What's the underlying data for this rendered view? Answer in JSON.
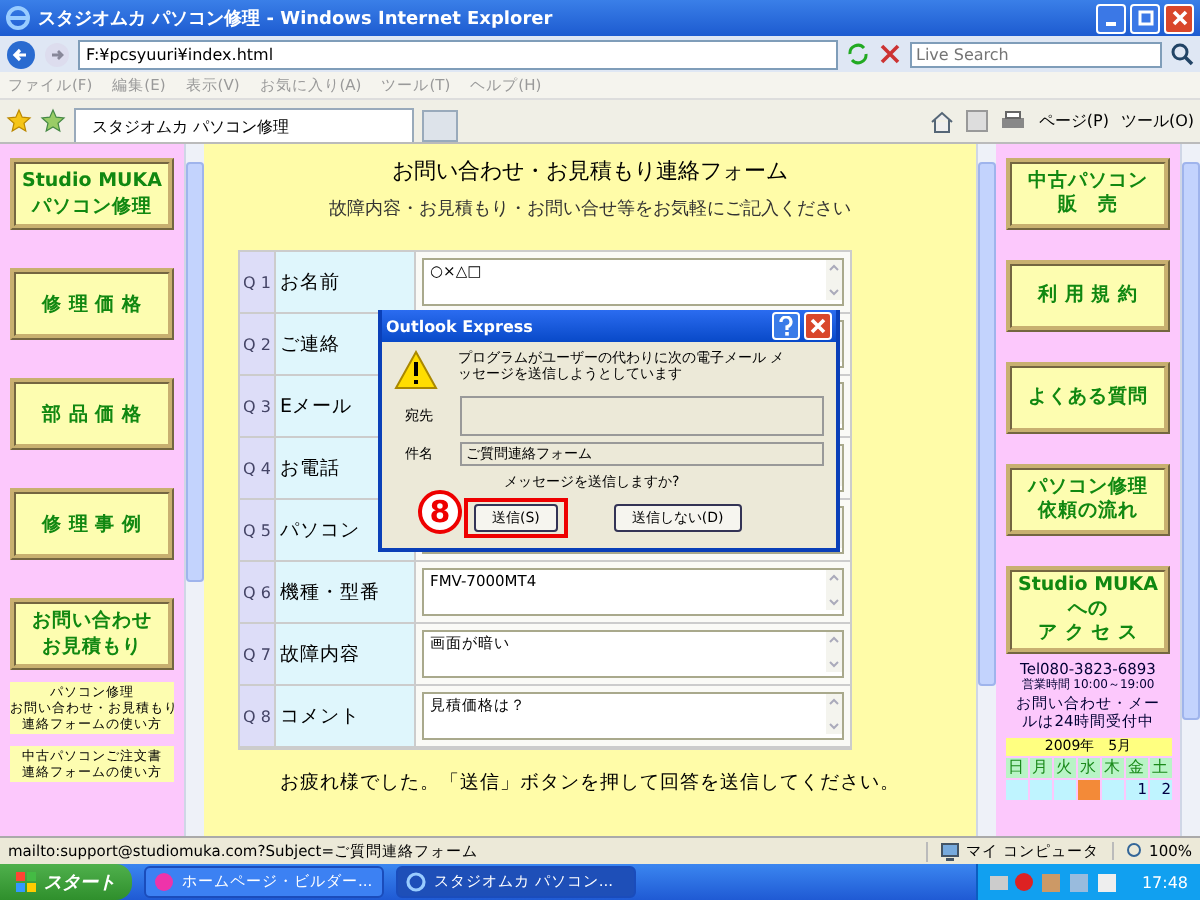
{
  "window": {
    "title": "スタジオムカ パソコン修理 - Windows Internet Explorer"
  },
  "address_bar": {
    "url": "F:¥pcsyuuri¥index.html",
    "search_placeholder": "Live Search"
  },
  "menu": [
    "ファイル(F)",
    "編集(E)",
    "表示(V)",
    "お気に入り(A)",
    "ツール(T)",
    "ヘルプ(H)"
  ],
  "tab": {
    "label": "スタジオムカ パソコン修理"
  },
  "toolbar": [
    "ページ(P)",
    "ツール(O)"
  ],
  "left_nav": {
    "buttons": [
      {
        "lines": [
          "Studio MUKA",
          "パソコン修理"
        ]
      },
      {
        "lines": [
          "修 理 価 格"
        ]
      },
      {
        "lines": [
          "部 品 価 格"
        ]
      },
      {
        "lines": [
          "修 理 事 例"
        ]
      },
      {
        "lines": [
          "お問い合わせ",
          "お見積もり"
        ]
      }
    ],
    "guides": [
      {
        "lines": [
          "パソコン修理",
          "お問い合わせ・お見積もり",
          "連絡フォームの使い方"
        ]
      },
      {
        "lines": [
          "中古パソコンご注文書",
          "連絡フォームの使い方"
        ]
      }
    ]
  },
  "form": {
    "title": "お問い合わせ・お見積もり連絡フォーム",
    "intro": "故障内容・お見積もり・お問い合せ等をお気軽にご記入ください",
    "questions": [
      {
        "number": "Q 1",
        "label": "お名前",
        "value": "○×△□"
      },
      {
        "number": "Q 2",
        "label": "ご連絡"
      },
      {
        "number": "Q 3",
        "label": "Eメール"
      },
      {
        "number": "Q 4",
        "label": "お電話"
      },
      {
        "number": "Q 5",
        "label": "パソコン"
      },
      {
        "number": "Q 6",
        "label": "機種・型番",
        "value": "FMV-7000MT4"
      },
      {
        "number": "Q 7",
        "label": "故障内容",
        "value": "画面が暗い"
      },
      {
        "number": "Q 8",
        "label": "コメント",
        "value": "見積価格は？"
      }
    ],
    "footer": "お疲れ様でした。「送信」ボタンを押して回答を送信してください。"
  },
  "right_nav": {
    "buttons": [
      {
        "lines": [
          "中古パソコン",
          "販　売"
        ]
      },
      {
        "lines": [
          "利 用 規 約"
        ]
      },
      {
        "lines": [
          "よくある質問"
        ]
      },
      {
        "lines": [
          "パソコン修理",
          "依頼の流れ"
        ]
      },
      {
        "lines": [
          "Studio MUKA",
          "への",
          "ア ク セ ス"
        ]
      }
    ],
    "contact": {
      "phone": "Tel080-3823-6893",
      "hours": "営業時間 10:00～19:00",
      "note_lines": [
        "お問い合わせ・メー",
        "ルは24時間受付中"
      ]
    },
    "calendar": {
      "title": "2009年　5月",
      "weekdays": [
        "日",
        "月",
        "火",
        "水",
        "木",
        "金",
        "土"
      ],
      "days": [
        {
          "closed": false
        },
        {
          "closed": false
        },
        {
          "closed": false
        },
        {
          "closed": true
        },
        {
          "closed": false
        },
        {
          "day": "1",
          "closed": false
        },
        {
          "day": "2",
          "closed": false
        }
      ]
    }
  },
  "dialog": {
    "title": "Outlook Express",
    "message": "プログラムがユーザーの代わりに次の電子メール メッセージを送信しようとしています",
    "to_label": "宛先",
    "subject_label": "件名",
    "subject": "ご質問連絡フォーム",
    "question": "メッセージを送信しますか?",
    "buttons": [
      {
        "label": "送信(S)",
        "highlighted": true
      },
      {
        "label": "送信しない(D)",
        "highlighted": false
      }
    ]
  },
  "annotation": {
    "step": "8"
  },
  "status_bar": {
    "text": "mailto:support@studiomuka.com?Subject=ご質問連絡フォーム",
    "zone": "マイ コンピュータ",
    "zoom": "100%"
  },
  "taskbar": {
    "start": "スタート",
    "items": [
      {
        "label": "ホームページ・ビルダー...",
        "selected": false
      },
      {
        "label": "スタジオムカ パソコン...",
        "selected": true
      }
    ],
    "clock": "17:48"
  }
}
